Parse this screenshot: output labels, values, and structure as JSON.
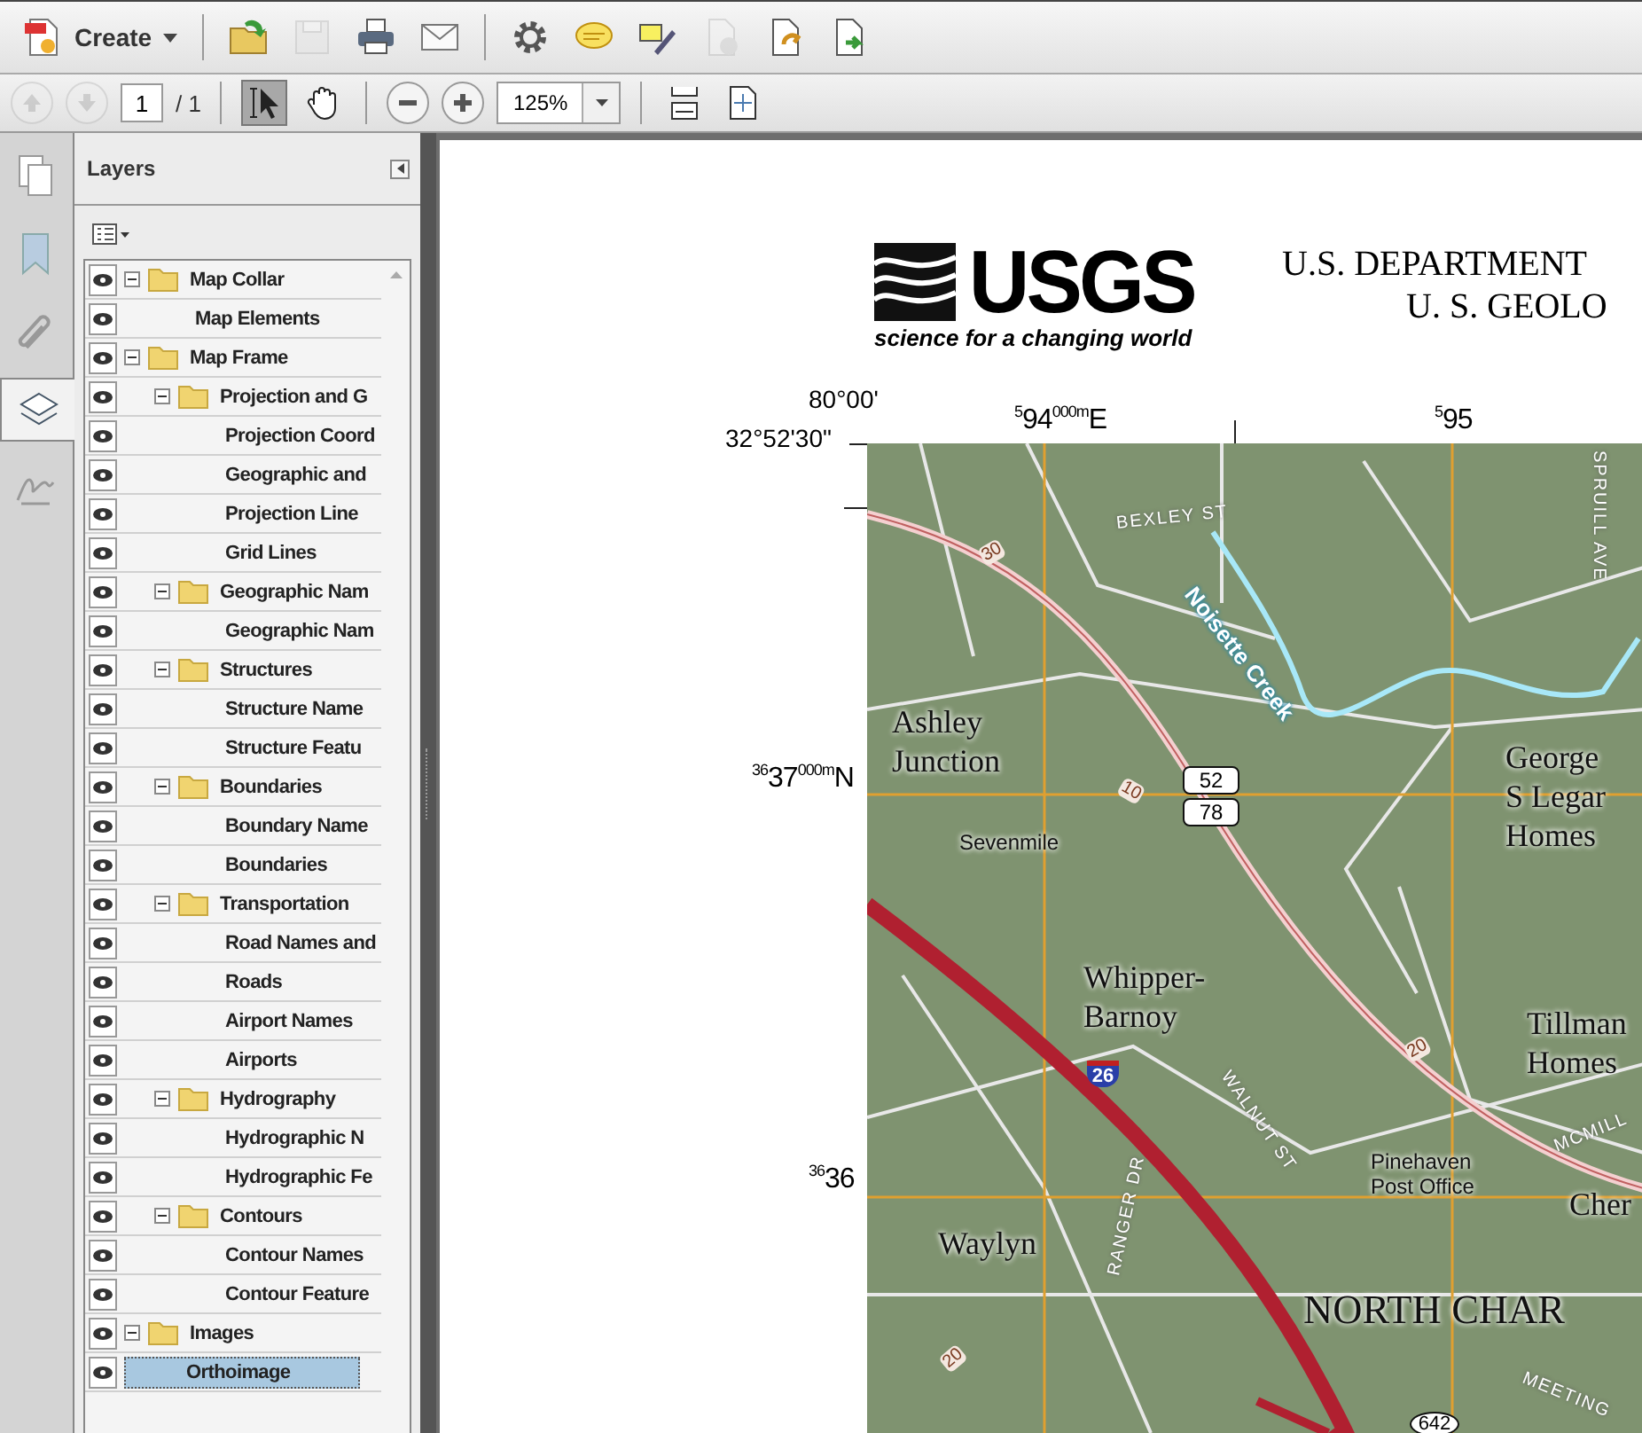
{
  "toolbar": {
    "create": {
      "label": "Create"
    },
    "buttons": [
      {
        "kind": "open",
        "disabled": false
      },
      {
        "kind": "save",
        "disabled": true
      },
      {
        "kind": "print",
        "disabled": false
      },
      {
        "kind": "email",
        "disabled": false
      },
      {
        "kind": "gear",
        "disabled": false
      },
      {
        "kind": "comment",
        "disabled": false
      },
      {
        "kind": "sign",
        "disabled": false
      },
      {
        "kind": "docx",
        "disabled": true
      },
      {
        "kind": "docarrow",
        "disabled": false
      },
      {
        "kind": "docexport",
        "disabled": false
      }
    ]
  },
  "nav_toolbar": {
    "prev_disabled": true,
    "next_disabled": true,
    "page": "1",
    "page_total": "/ 1",
    "tools": [
      {
        "kind": "select",
        "selected": true
      },
      {
        "kind": "hand",
        "selected": false
      }
    ],
    "zoom": "125%"
  },
  "side_tabs": [
    {
      "kind": "pages",
      "selected": false
    },
    {
      "kind": "bookmarks",
      "selected": false
    },
    {
      "kind": "attachments",
      "selected": false
    },
    {
      "kind": "layers",
      "selected": true
    },
    {
      "kind": "signatures",
      "selected": false
    }
  ],
  "layers_panel": {
    "title": "Layers",
    "tree": [
      {
        "label": "Map Collar",
        "visible": true,
        "selected": false,
        "expanded": true,
        "children": [
          {
            "label": "Map Elements",
            "visible": true,
            "selected": false
          }
        ]
      },
      {
        "label": "Map Frame",
        "visible": true,
        "selected": false,
        "expanded": true,
        "children": [
          {
            "label": "Projection and G",
            "visible": true,
            "selected": false,
            "expanded": true,
            "children": [
              {
                "label": "Projection Coord",
                "visible": true,
                "selected": false
              },
              {
                "label": "Geographic and",
                "visible": true,
                "selected": false
              },
              {
                "label": "Projection Line",
                "visible": true,
                "selected": false
              },
              {
                "label": "Grid Lines",
                "visible": true,
                "selected": false
              }
            ]
          },
          {
            "label": "Geographic Nam",
            "visible": true,
            "selected": false,
            "expanded": true,
            "children": [
              {
                "label": "Geographic Nam",
                "visible": true,
                "selected": false
              }
            ]
          },
          {
            "label": "Structures",
            "visible": true,
            "selected": false,
            "expanded": true,
            "children": [
              {
                "label": "Structure Name",
                "visible": true,
                "selected": false
              },
              {
                "label": "Structure Featu",
                "visible": true,
                "selected": false
              }
            ]
          },
          {
            "label": "Boundaries",
            "visible": true,
            "selected": false,
            "expanded": true,
            "children": [
              {
                "label": "Boundary Name",
                "visible": true,
                "selected": false
              },
              {
                "label": "Boundaries",
                "visible": true,
                "selected": false
              }
            ]
          },
          {
            "label": "Transportation",
            "visible": true,
            "selected": false,
            "expanded": true,
            "children": [
              {
                "label": "Road Names and",
                "visible": true,
                "selected": false
              },
              {
                "label": "Roads",
                "visible": true,
                "selected": false
              },
              {
                "label": "Airport Names",
                "visible": true,
                "selected": false
              },
              {
                "label": "Airports",
                "visible": true,
                "selected": false
              }
            ]
          },
          {
            "label": "Hydrography",
            "visible": true,
            "selected": false,
            "expanded": true,
            "children": [
              {
                "label": "Hydrographic N",
                "visible": true,
                "selected": false
              },
              {
                "label": "Hydrographic Fe",
                "visible": true,
                "selected": false
              }
            ]
          },
          {
            "label": "Contours",
            "visible": true,
            "selected": false,
            "expanded": true,
            "children": [
              {
                "label": "Contour Names",
                "visible": true,
                "selected": false
              },
              {
                "label": "Contour Feature",
                "visible": true,
                "selected": false
              }
            ]
          }
        ]
      },
      {
        "label": "Images",
        "visible": true,
        "selected": false,
        "expanded": true,
        "children": [
          {
            "label": "Orthoimage",
            "visible": true,
            "selected": true
          }
        ]
      }
    ]
  },
  "document": {
    "logo": {
      "wordmark": "USGS",
      "tagline": "science for a changing world"
    },
    "header_lines": [
      "U.S. DEPARTMENT",
      "U. S. GEOLO"
    ],
    "coordinates": [
      {
        "kind": "lon",
        "text": "80°00'"
      },
      {
        "kind": "lat",
        "text": "32°52'30\""
      },
      {
        "kind": "easting",
        "text": "$^{5}$94$^{000m}$E"
      },
      {
        "kind": "easting2",
        "text": "$^{5}$95"
      },
      {
        "kind": "northing",
        "text": "$^{36}$37$^{000m}$N"
      },
      {
        "kind": "northing2",
        "text": "$^{36}$36"
      }
    ],
    "map_labels": [
      {
        "kind": "street",
        "text": "SPRUILL AVE"
      },
      {
        "kind": "street",
        "text": "BEXLEY ST"
      },
      {
        "kind": "contour",
        "text": "30"
      },
      {
        "kind": "creek",
        "text": "Noisette Creek"
      },
      {
        "kind": "place",
        "text": "Ashley Junction"
      },
      {
        "kind": "place",
        "text": "George S Legar Homes"
      },
      {
        "kind": "contour",
        "text": "10"
      },
      {
        "kind": "us_shield",
        "text": "52"
      },
      {
        "kind": "us_shield",
        "text": "78"
      },
      {
        "kind": "small_place",
        "text": "Sevenmile"
      },
      {
        "kind": "place",
        "text": "Whipper-Barnoy"
      },
      {
        "kind": "street",
        "text": "WALNUT ST"
      },
      {
        "kind": "place",
        "text": "Tillman Homes"
      },
      {
        "kind": "contour",
        "text": "20"
      },
      {
        "kind": "interstate",
        "text": "26"
      },
      {
        "kind": "street",
        "text": "MCMILL"
      },
      {
        "kind": "small_place",
        "text": "Pinehaven Post Office"
      },
      {
        "kind": "place",
        "text": "Cher"
      },
      {
        "kind": "place",
        "text": "Waylyn"
      },
      {
        "kind": "street",
        "text": "RANGER DR"
      },
      {
        "kind": "city",
        "text": "NORTH CHAR"
      },
      {
        "kind": "contour",
        "text": "20"
      },
      {
        "kind": "street",
        "text": "MEETING"
      },
      {
        "kind": "state_shield",
        "text": "642"
      }
    ]
  }
}
